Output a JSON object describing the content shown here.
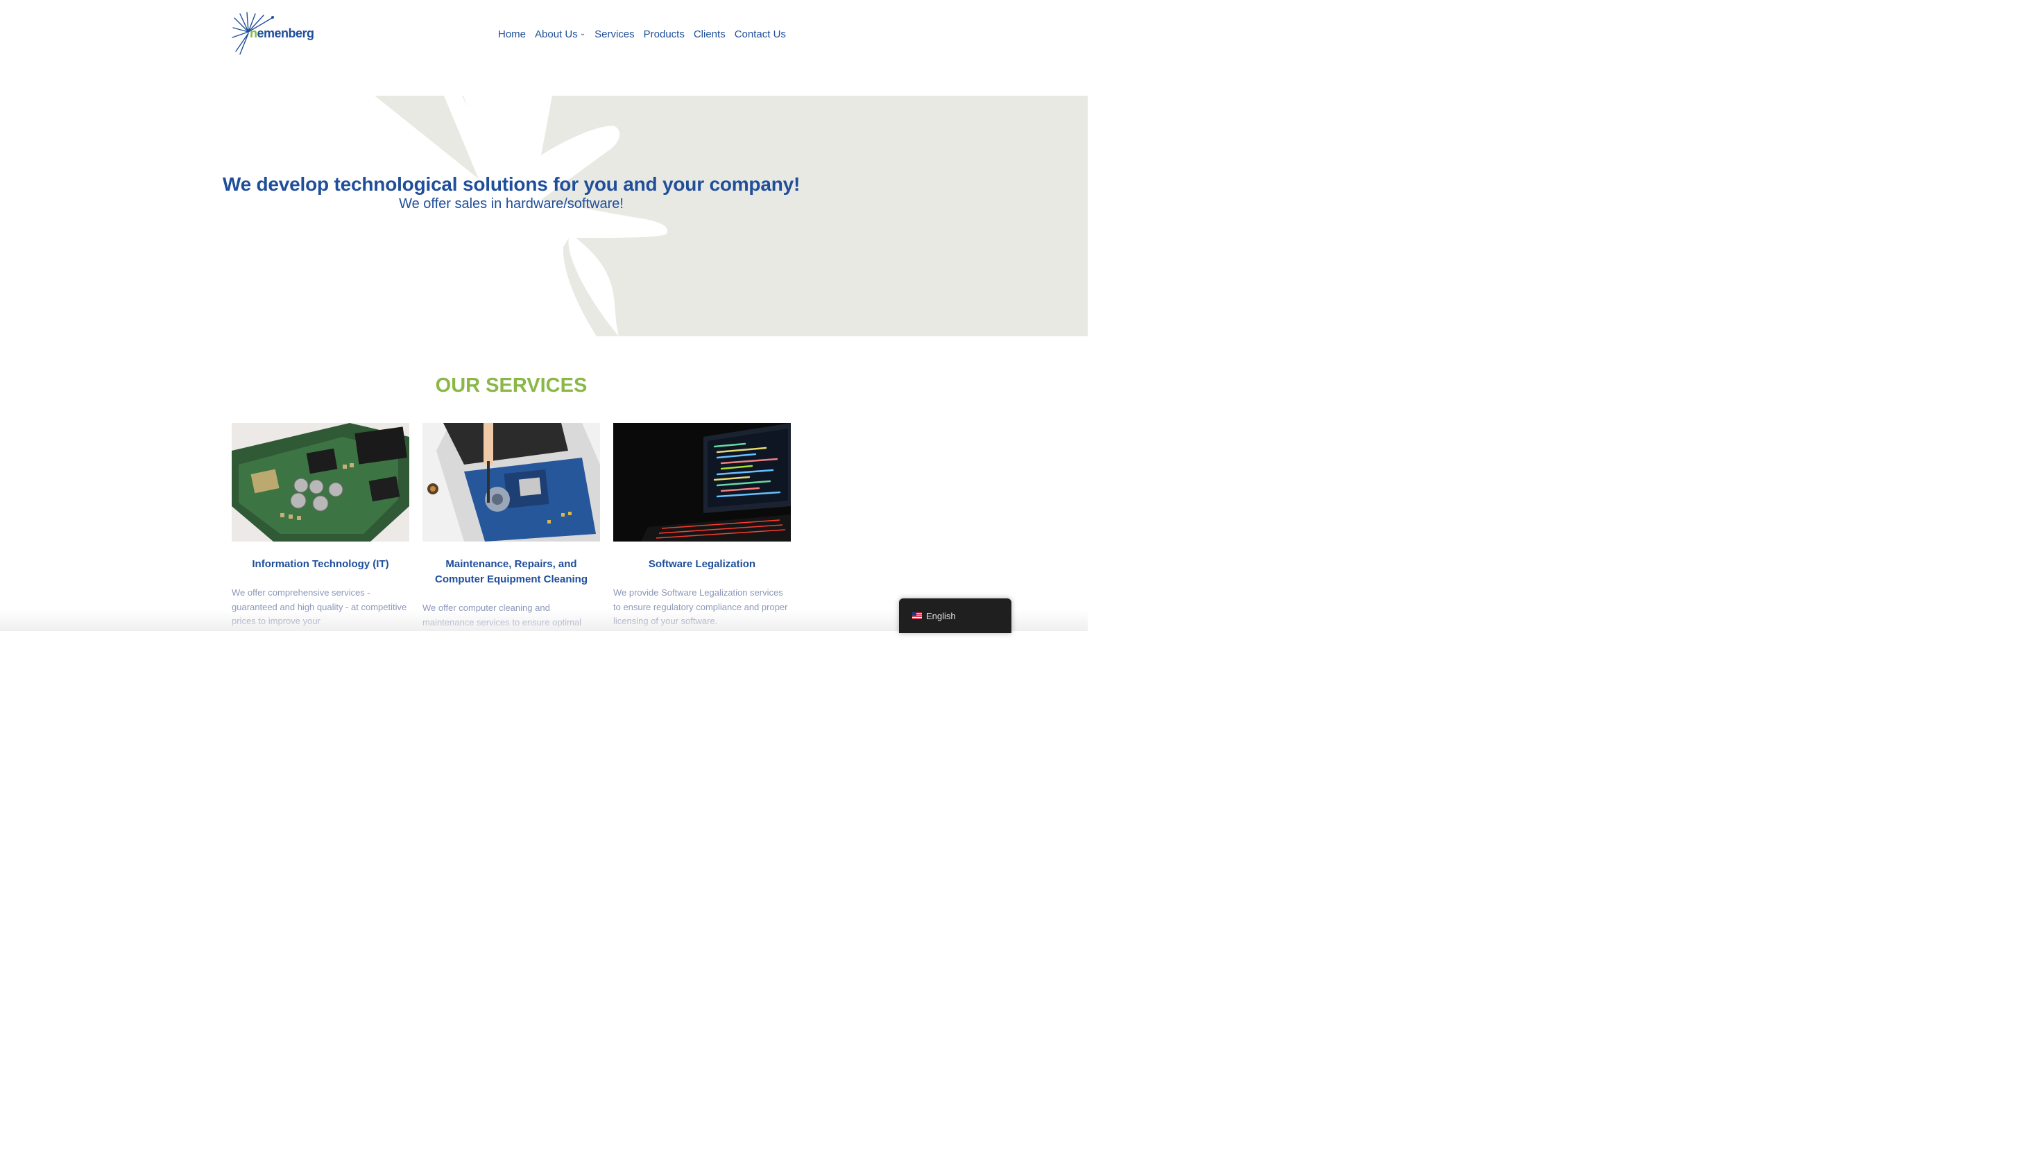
{
  "header": {
    "logo": {
      "text_first": "n",
      "text_rest": "emenberg",
      "icon": "sunburst-logo-icon"
    },
    "nav": [
      {
        "label": "Home"
      },
      {
        "label": "About Us",
        "has_dropdown": true
      },
      {
        "label": "Services"
      },
      {
        "label": "Products"
      },
      {
        "label": "Clients"
      },
      {
        "label": "Contact Us"
      }
    ]
  },
  "hero": {
    "title": "We develop technological solutions for you and your company!",
    "subtitle": "We offer sales in hardware/software!"
  },
  "services": {
    "heading": "OUR SERVICES",
    "cards": [
      {
        "title": "Information Technology (IT)",
        "text": "We offer comprehensive services - guaranteed and high quality - at competitive prices to improve your",
        "image": "circuit-board-image"
      },
      {
        "title": "Maintenance, Repairs, and Computer Equipment Cleaning",
        "text": "We offer computer cleaning and maintenance services to ensure optimal",
        "image": "laptop-repair-image"
      },
      {
        "title": "Software Legalization",
        "text": "We provide Software Legalization services to ensure regulatory compliance and proper licensing of your software.",
        "image": "laptop-code-image"
      }
    ]
  },
  "language_switcher": {
    "label": "English",
    "flag": "us-flag-icon"
  },
  "colors": {
    "brand_blue": "#1f4e9a",
    "brand_green": "#8ab846",
    "hero_shape": "#e9e9e4",
    "muted_text": "#8c98b8",
    "switcher_bg": "#1f1f1f"
  }
}
